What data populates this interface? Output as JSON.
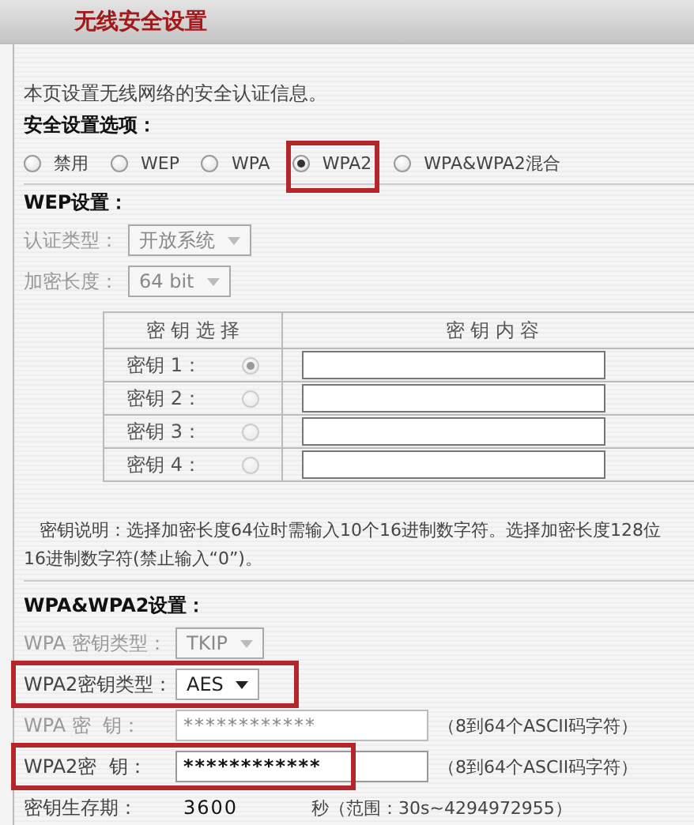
{
  "header": {
    "title": "无线安全设置"
  },
  "intro": "本页设置无线网络的安全认证信息。",
  "security": {
    "heading": "安全设置选项：",
    "options": [
      {
        "label": "禁用",
        "selected": false,
        "highlighted": false
      },
      {
        "label": "WEP",
        "selected": false,
        "highlighted": false
      },
      {
        "label": "WPA",
        "selected": false,
        "highlighted": false
      },
      {
        "label": "WPA2",
        "selected": true,
        "highlighted": true
      },
      {
        "label": "WPA&WPA2混合",
        "selected": false,
        "highlighted": false
      }
    ]
  },
  "wep": {
    "heading": "WEP设置：",
    "fields": [
      {
        "label": "认证类型：",
        "value": "开放系统",
        "disabled": true
      },
      {
        "label": "加密长度：",
        "value": "64 bit",
        "disabled": true
      }
    ],
    "key_table": {
      "columns": [
        "密 钥 选 择",
        "密 钥 内 容"
      ],
      "rows": [
        {
          "label": "密钥 1：",
          "selected": true
        },
        {
          "label": "密钥 2：",
          "selected": false
        },
        {
          "label": "密钥 3：",
          "selected": false
        },
        {
          "label": "密钥 4：",
          "selected": false
        }
      ]
    },
    "note": [
      "密钥说明：选择加密长度64位时需输入10个16进制数字符。选择加密长度128位",
      "16进制数字符(禁止输入“0”)。"
    ]
  },
  "wpa": {
    "heading": "WPA&WPA2设置：",
    "fields": [
      {
        "kind": "select",
        "label": "WPA 密钥类型：",
        "value": "TKIP",
        "disabled": true,
        "highlighted": false
      },
      {
        "kind": "select",
        "label": "WPA2密钥类型：",
        "value": "AES",
        "disabled": false,
        "highlighted": true
      },
      {
        "kind": "password",
        "label": "WPA 密  钥：",
        "value": "************",
        "disabled": true,
        "highlighted": false,
        "hint": "（8到64个ASCII码字符）"
      },
      {
        "kind": "password",
        "label": "WPA2密  钥：",
        "value": "************",
        "disabled": false,
        "highlighted": true,
        "hint": "（8到64个ASCII码字符）"
      },
      {
        "kind": "text",
        "label": "密钥生存期：",
        "value": "3600",
        "highlighted": false,
        "hint": "秒（范围：30s~4294972955）"
      }
    ]
  }
}
